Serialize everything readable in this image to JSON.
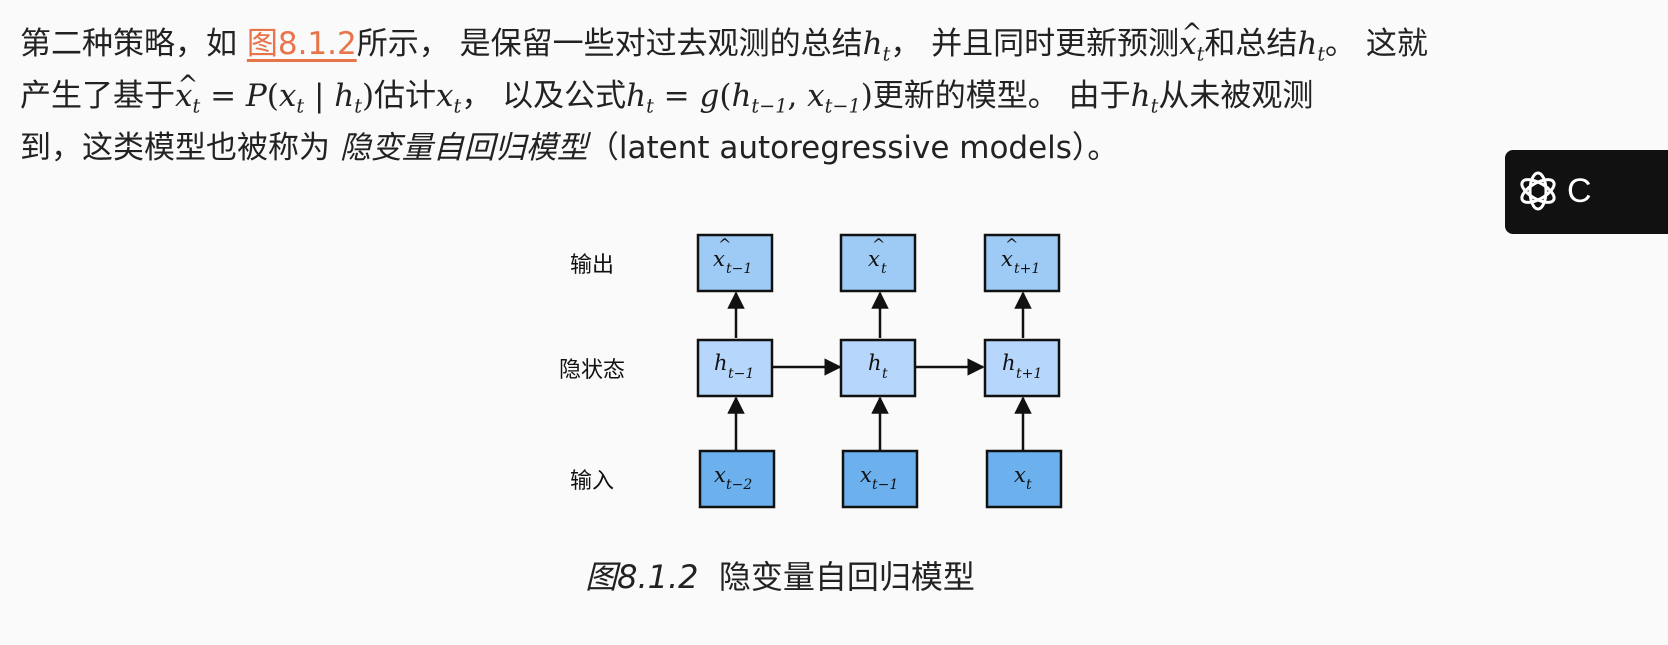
{
  "paragraph": {
    "l1_a": "第二种策略，如 ",
    "link": "图8.1.2",
    "l1_b": "所示， 是保留一些对过去观测的总结",
    "l1_c": "， 并且同时更新预测",
    "l1_d": "和总结",
    "l1_e": "。 这就",
    "l2_a": "产生了基于",
    "l2_b": "估计",
    "l2_c": "， 以及公式",
    "l2_d": "更新的模型。 由于",
    "l2_e": "从未被观测",
    "l3_a": "到，这类模型也被称为 ",
    "l3_em": "隐变量自回归模型",
    "l3_b": "（latent autoregressive models）。"
  },
  "widget": {
    "rest_char": "C"
  },
  "diagram": {
    "row_labels": [
      "输出",
      "隐状态",
      "输入"
    ],
    "outputs": [
      {
        "var": "x",
        "sub": "t−1"
      },
      {
        "var": "x",
        "sub": "t"
      },
      {
        "var": "x",
        "sub": "t+1"
      }
    ],
    "hidden": [
      {
        "var": "h",
        "sub": "t−1"
      },
      {
        "var": "h",
        "sub": "t"
      },
      {
        "var": "h",
        "sub": "t+1"
      }
    ],
    "inputs": [
      {
        "var": "x",
        "sub": "t−2"
      },
      {
        "var": "x",
        "sub": "t−1"
      },
      {
        "var": "x",
        "sub": "t"
      }
    ],
    "colors": {
      "output_fill": "#9ecbf5",
      "hidden_fill": "#b6d7fb",
      "input_fill": "#6cb0ee",
      "stroke": "#111111"
    }
  },
  "caption": {
    "num": "图8.1.2",
    "text": "  隐变量自回归模型"
  }
}
